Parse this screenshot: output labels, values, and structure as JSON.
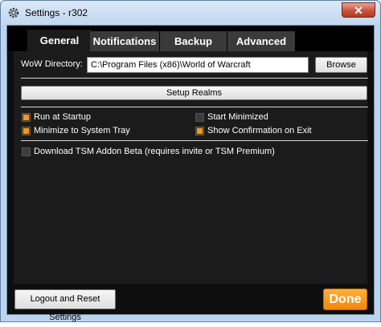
{
  "window": {
    "title": "Settings - r302",
    "close_glyph": "✕"
  },
  "tabs": [
    {
      "label": "General",
      "active": true
    },
    {
      "label": "Notifications",
      "active": false
    },
    {
      "label": "Backup",
      "active": false
    },
    {
      "label": "Advanced",
      "active": false
    }
  ],
  "general": {
    "wow_dir_label": "WoW Directory:",
    "wow_dir_value": "C:\\Program Files (x86)\\World of Warcraft",
    "browse_label": "Browse",
    "setup_realms_label": "Setup Realms",
    "options": {
      "run_at_startup": {
        "label": "Run at Startup",
        "checked": true
      },
      "start_minimized": {
        "label": "Start Minimized",
        "checked": false
      },
      "minimize_to_tray": {
        "label": "Minimize to System Tray",
        "checked": true
      },
      "confirm_on_exit": {
        "label": "Show Confirmation on Exit",
        "checked": true
      },
      "download_beta": {
        "label": "Download TSM Addon Beta (requires invite or TSM Premium)",
        "checked": false
      }
    }
  },
  "footer": {
    "logout_reset_label": "Logout and Reset Settings",
    "done_label": "Done"
  },
  "colors": {
    "accent": "#f29a1b",
    "background": "#1b1b1b",
    "tab_bar": "#000000"
  },
  "icons": {
    "app": "gear-icon",
    "close": "close-icon"
  }
}
